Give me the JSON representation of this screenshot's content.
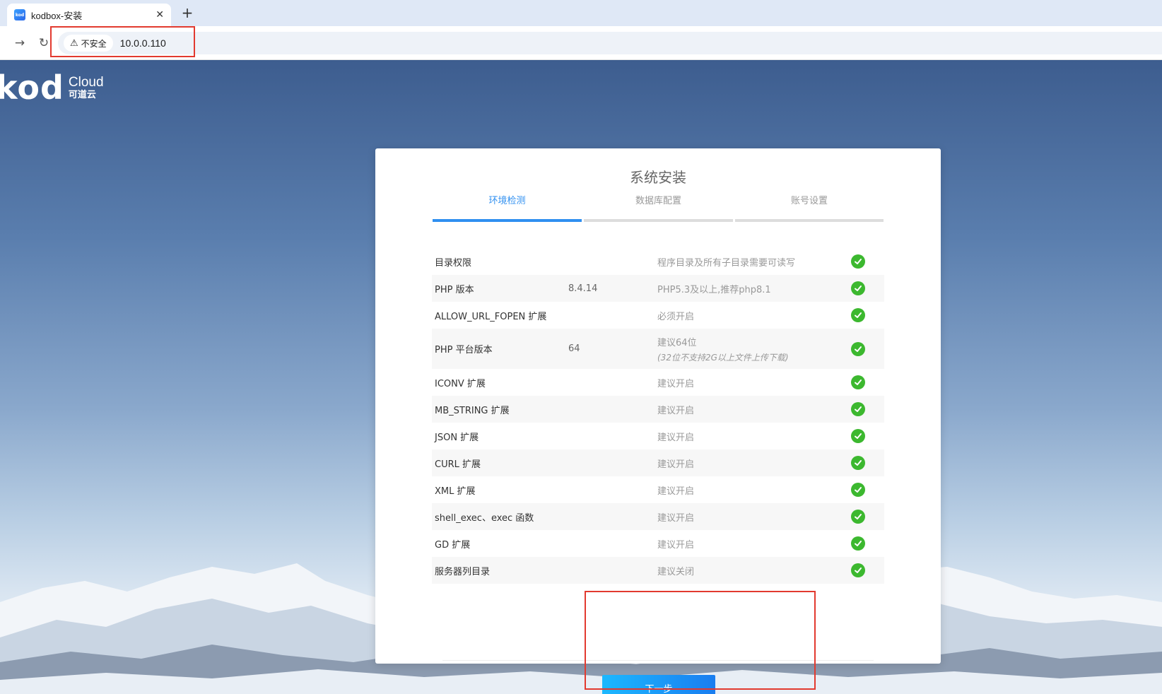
{
  "browser": {
    "tab_title": "kodbox-安装",
    "favicon_text": "kod",
    "tab_close": "✕",
    "new_tab": "+",
    "back": "←",
    "forward": "→",
    "reload": "↻",
    "security_warn": "⚠",
    "security_label": "不安全",
    "url": "10.0.0.110"
  },
  "logo": {
    "mark": "kod",
    "cloud": "Cloud",
    "cn": "可道云"
  },
  "install": {
    "title": "系统安装",
    "steps": [
      {
        "label": "环境检测",
        "active": true
      },
      {
        "label": "数据库配置",
        "active": false
      },
      {
        "label": "账号设置",
        "active": false
      }
    ],
    "checks": [
      {
        "name": "目录权限",
        "value": "",
        "desc": "程序目录及所有子目录需要可读写",
        "sub": ""
      },
      {
        "name": "PHP 版本",
        "value": "8.4.14",
        "desc": "PHP5.3及以上,推荐php8.1",
        "sub": ""
      },
      {
        "name": "ALLOW_URL_FOPEN 扩展",
        "value": "",
        "desc": "必须开启",
        "sub": ""
      },
      {
        "name": "PHP 平台版本",
        "value": "64",
        "desc": "建议64位",
        "sub": "(32位不支持2G以上文件上传下载)"
      },
      {
        "name": "ICONV 扩展",
        "value": "",
        "desc": "建议开启",
        "sub": ""
      },
      {
        "name": "MB_STRING 扩展",
        "value": "",
        "desc": "建议开启",
        "sub": ""
      },
      {
        "name": "JSON 扩展",
        "value": "",
        "desc": "建议开启",
        "sub": ""
      },
      {
        "name": "CURL 扩展",
        "value": "",
        "desc": "建议开启",
        "sub": ""
      },
      {
        "name": "XML 扩展",
        "value": "",
        "desc": "建议开启",
        "sub": ""
      },
      {
        "name": "shell_exec、exec 函数",
        "value": "",
        "desc": "建议开启",
        "sub": ""
      },
      {
        "name": "GD 扩展",
        "value": "",
        "desc": "建议开启",
        "sub": ""
      },
      {
        "name": "服务器列目录",
        "value": "",
        "desc": "建议关闭",
        "sub": ""
      }
    ],
    "next_label": "下一步"
  },
  "colors": {
    "accent": "#2f8ff0",
    "success": "#3cb82f",
    "highlight": "#e23a2f"
  }
}
